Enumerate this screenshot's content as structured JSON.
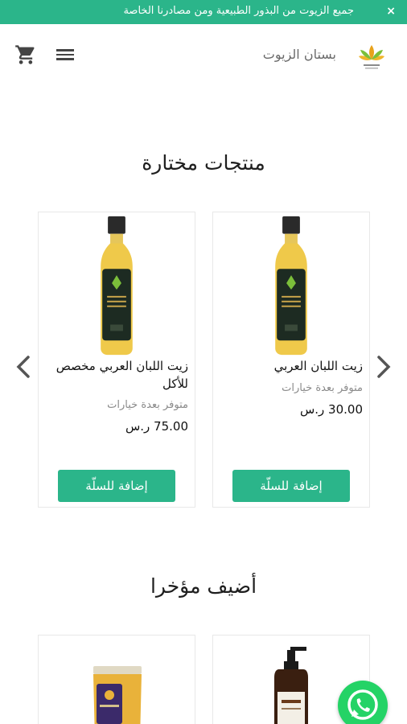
{
  "announcement": {
    "text": "جميع الزيوت من البذور الطبيعية ومن مصادرنا الخاصة",
    "close_label": "×"
  },
  "header": {
    "site_name": "بستان الزيوت",
    "logo_text": "بستان الزيوت"
  },
  "featured": {
    "title": "منتجات مختارة",
    "products": [
      {
        "name": "زيت اللبان العربي",
        "availability": "متوفر بعدة خيارات",
        "price": "30.00 ر.س",
        "button": "إضافة للسلّة"
      },
      {
        "name": "زيت اللبان العربي مخصص للأكل",
        "availability": "متوفر بعدة خيارات",
        "price": "75.00 ر.س",
        "button": "إضافة للسلّة"
      }
    ]
  },
  "recent": {
    "title": "أضيف مؤخرا"
  },
  "colors": {
    "accent": "#2bb58a",
    "whatsapp": "#24d366"
  },
  "icons": [
    "close-icon",
    "menu-icon",
    "cart-icon",
    "chevron-left-icon",
    "chevron-right-icon",
    "whatsapp-icon"
  ]
}
